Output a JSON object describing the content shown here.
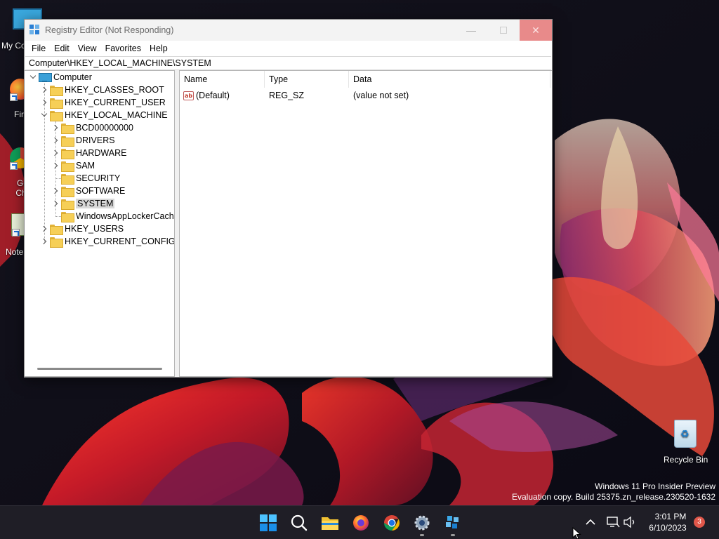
{
  "desktop": {
    "icons": [
      {
        "label": "My Co"
      },
      {
        "label": "Fir"
      },
      {
        "label": "Go Chr"
      },
      {
        "label": "Note"
      }
    ],
    "recycle_bin": {
      "label": "Recycle Bin"
    },
    "watermark": {
      "line1": "Windows 11 Pro Insider Preview",
      "line2": "Evaluation copy. Build 25375.zn_release.230520-1632"
    }
  },
  "window": {
    "title": "Registry Editor (Not Responding)",
    "menu": [
      "File",
      "Edit",
      "View",
      "Favorites",
      "Help"
    ],
    "address": "Computer\\HKEY_LOCAL_MACHINE\\SYSTEM",
    "tree": {
      "root": "Computer",
      "hives": [
        "HKEY_CLASSES_ROOT",
        "HKEY_CURRENT_USER",
        "HKEY_LOCAL_MACHINE",
        "HKEY_USERS",
        "HKEY_CURRENT_CONFIG"
      ],
      "hklm_children": [
        "BCD00000000",
        "DRIVERS",
        "HARDWARE",
        "SAM",
        "SECURITY",
        "SOFTWARE",
        "SYSTEM",
        "WindowsAppLockerCache"
      ],
      "selected": "SYSTEM"
    },
    "list": {
      "columns": [
        "Name",
        "Type",
        "Data"
      ],
      "rows": [
        {
          "name": "(Default)",
          "type": "REG_SZ",
          "data": "(value not set)",
          "icon": "string-value-icon"
        }
      ]
    }
  },
  "taskbar": {
    "apps": [
      "start-icon",
      "search-icon",
      "file-explorer-icon",
      "firefox-icon",
      "chrome-icon",
      "settings-icon",
      "registry-editor-icon"
    ],
    "clock": {
      "time": "3:01 PM",
      "date": "6/10/2023"
    },
    "notification_count": "3"
  },
  "colors": {
    "accent": "#0078d4",
    "close_button": "#e88a8a",
    "taskbar": "#1f1e26"
  }
}
